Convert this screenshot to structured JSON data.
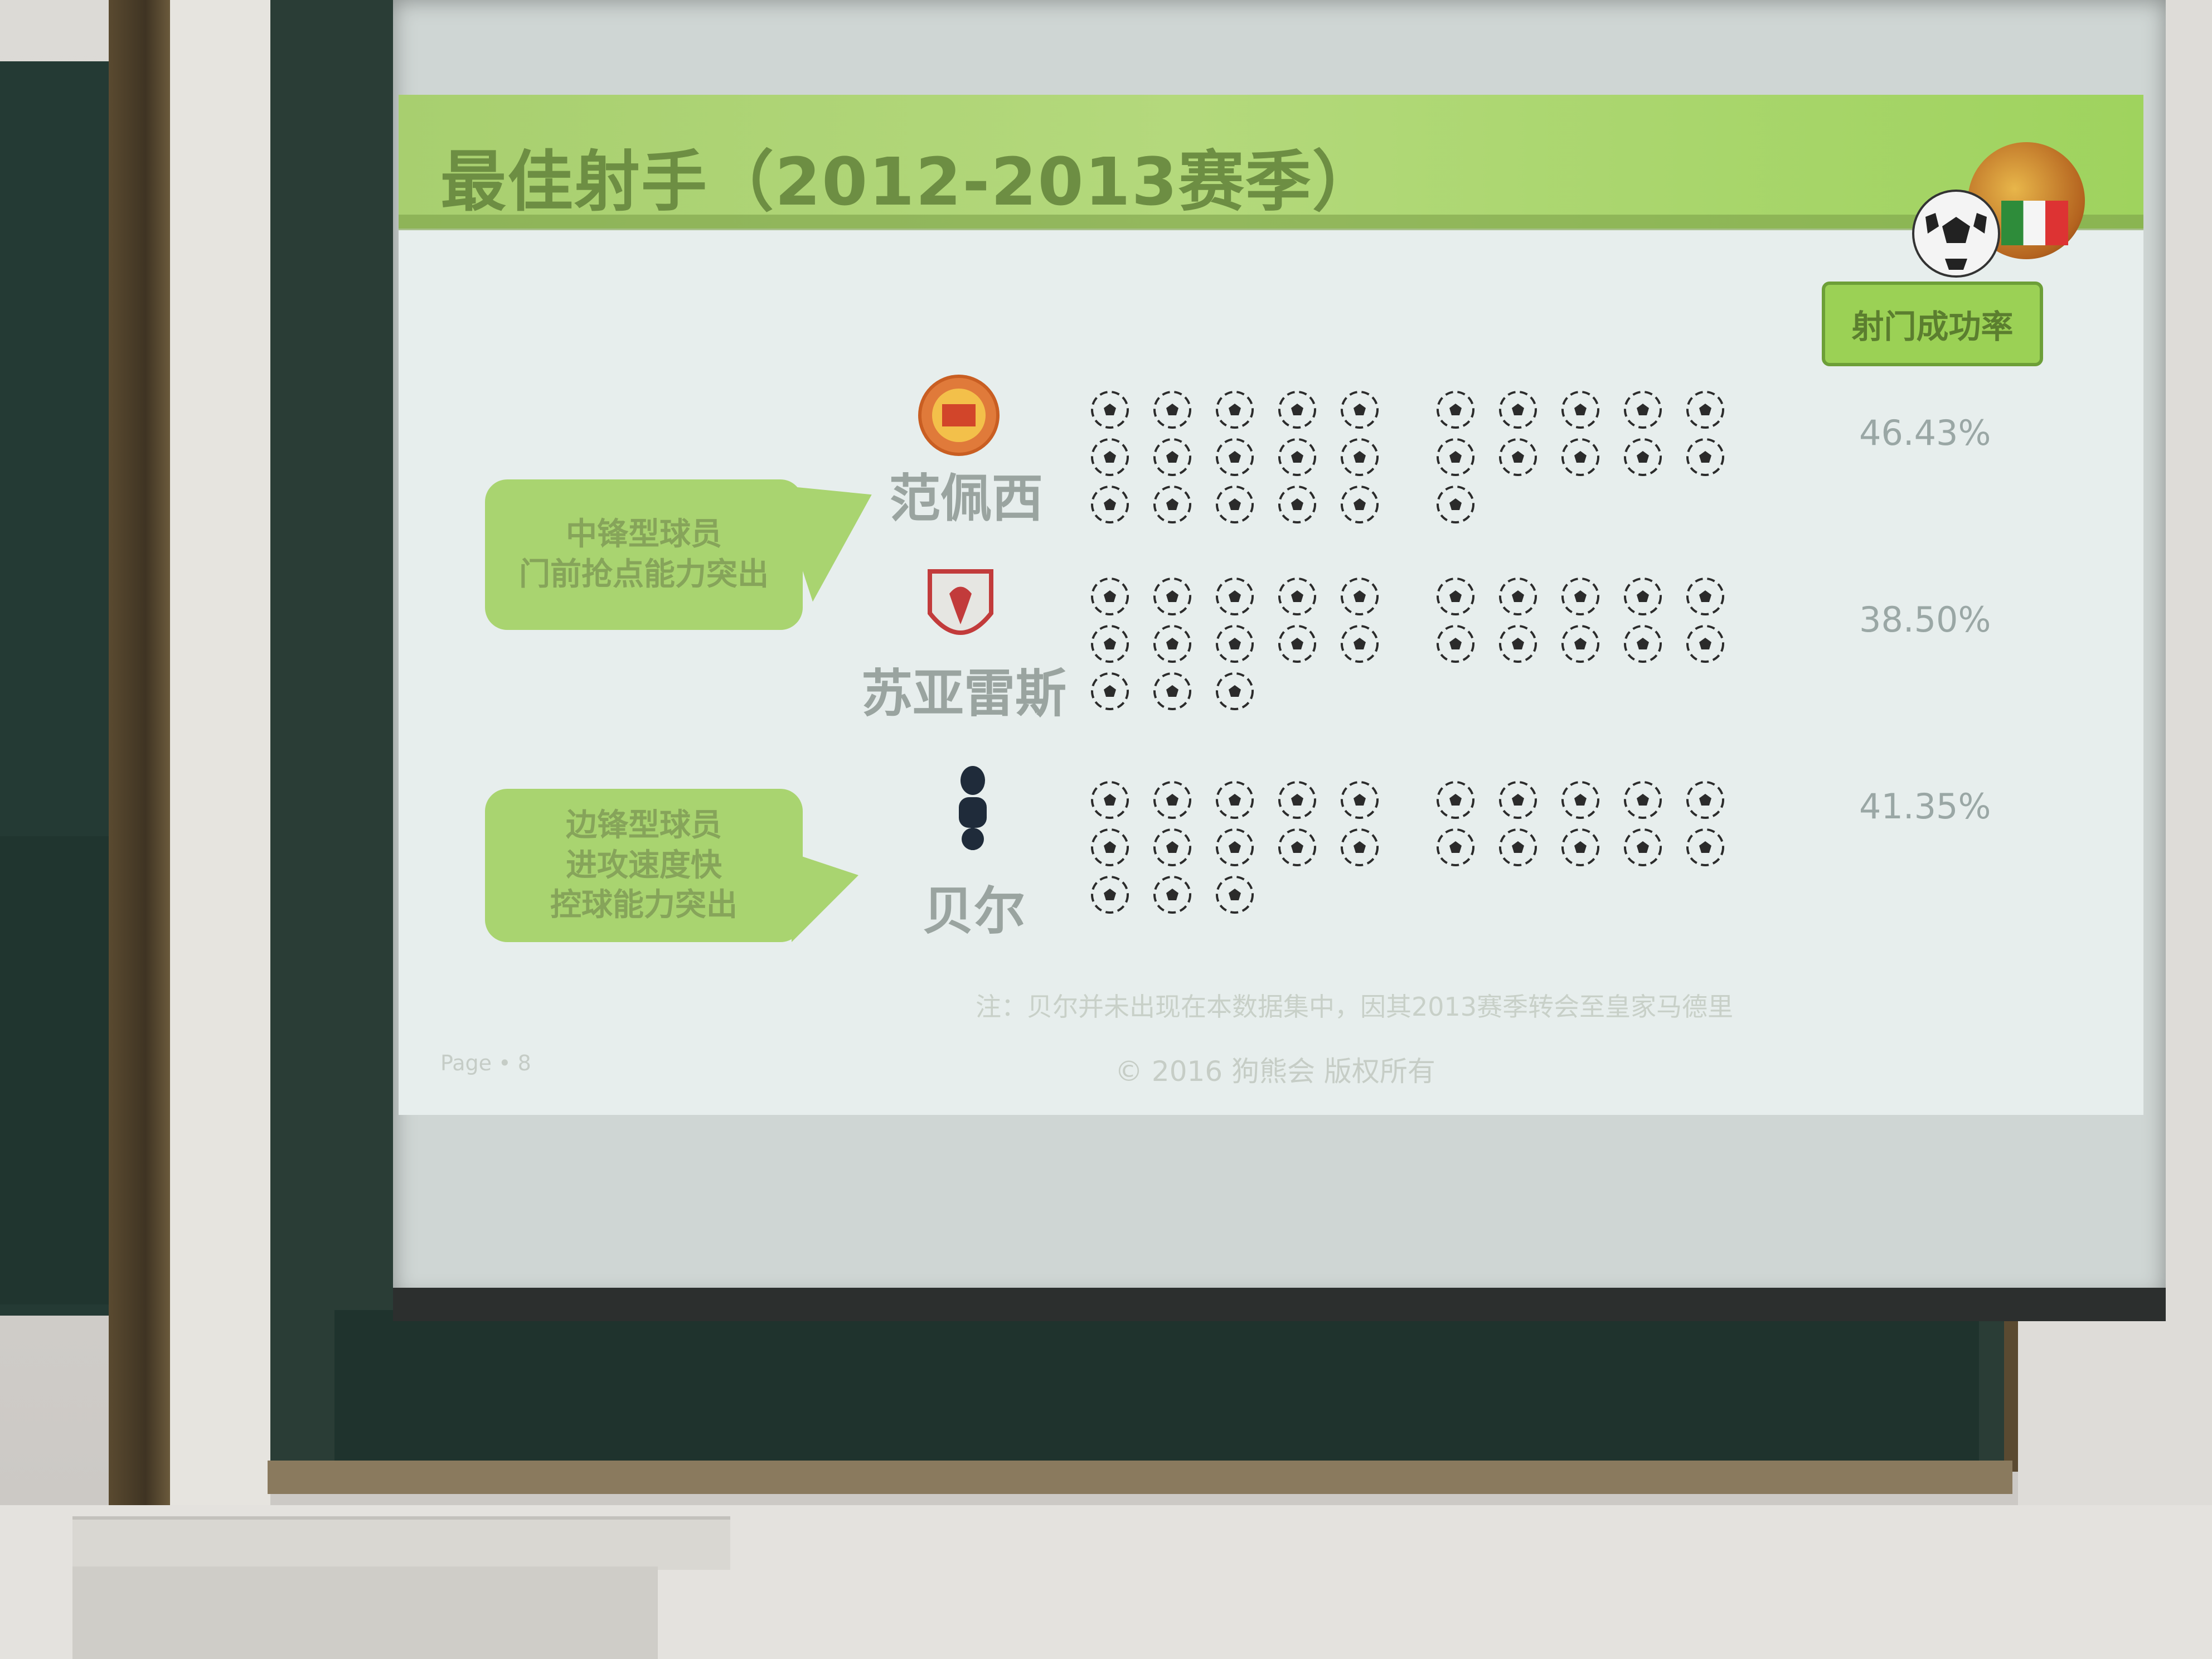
{
  "slide": {
    "title": "最佳射手（2012-2013赛季）",
    "rate_header": "射门成功率",
    "note": "注：贝尔并未出现在本数据集中，因其2013赛季转会至皇家马德里",
    "page_label": "Page • 8",
    "copyright": "© 2016 狗熊会 版权所有"
  },
  "callouts": [
    {
      "lines": [
        "中锋型球员",
        "门前抢点能力突出"
      ]
    },
    {
      "lines": [
        "边锋型球员",
        "进攻速度快",
        "控球能力突出"
      ]
    }
  ],
  "players": [
    {
      "name": "范佩西",
      "crest": "manchester-united-crest-icon",
      "rate": "46.43%",
      "balls": 26
    },
    {
      "name": "苏亚雷斯",
      "crest": "liverpool-crest-icon",
      "rate": "38.50%",
      "balls": 23
    },
    {
      "name": "贝尔",
      "crest": "tottenham-crest-icon",
      "rate": "41.35%",
      "balls": 23
    }
  ],
  "colors": {
    "accent_green": "#a9d470",
    "title_green": "#6d8e43",
    "slide_bg": "#e7eeed"
  }
}
